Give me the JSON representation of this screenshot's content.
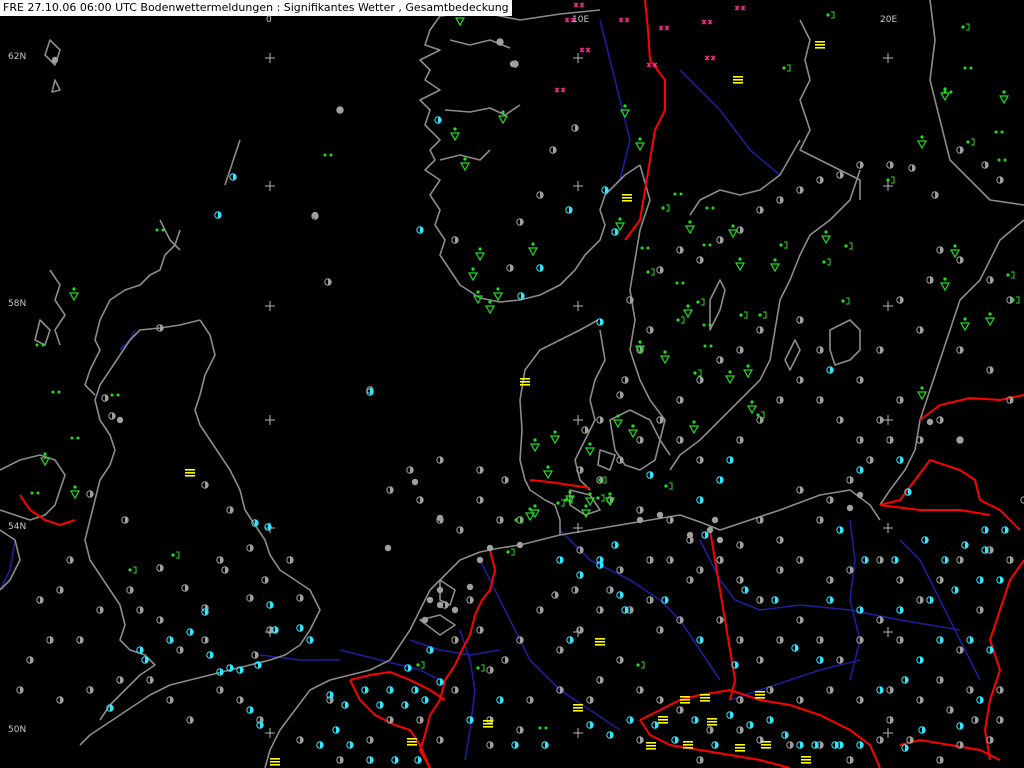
{
  "header": {
    "title": "FRE 27.10.06 06:00 UTC  Bodenwettermeldungen :  Signifikantes Wetter , Gesamtbedeckung"
  },
  "grid_labels": {
    "lon_0": "0",
    "lon_10e": "10E",
    "lon_20e": "20E",
    "lat_62n": "62N",
    "lat_58n": "58N",
    "lat_54n": "54N",
    "lat_50n": "50N"
  },
  "colors": {
    "background": "#000000",
    "coastline": "#8c8c8c",
    "border": "#ff0000",
    "river": "#1e1e9c",
    "grid_cross": "#b4b4b4",
    "cloud_cover": "#a0a0a0",
    "cloud_cover_partial": "#30e8ff",
    "drizzle_rain": "#20e020",
    "fog": "#ffff00",
    "snow": "#ff3090"
  },
  "legend_symbols": [
    "cloud-cover-circle",
    "rain-shower-symbol",
    "drizzle-dots",
    "fog-bars",
    "snow-stars"
  ]
}
